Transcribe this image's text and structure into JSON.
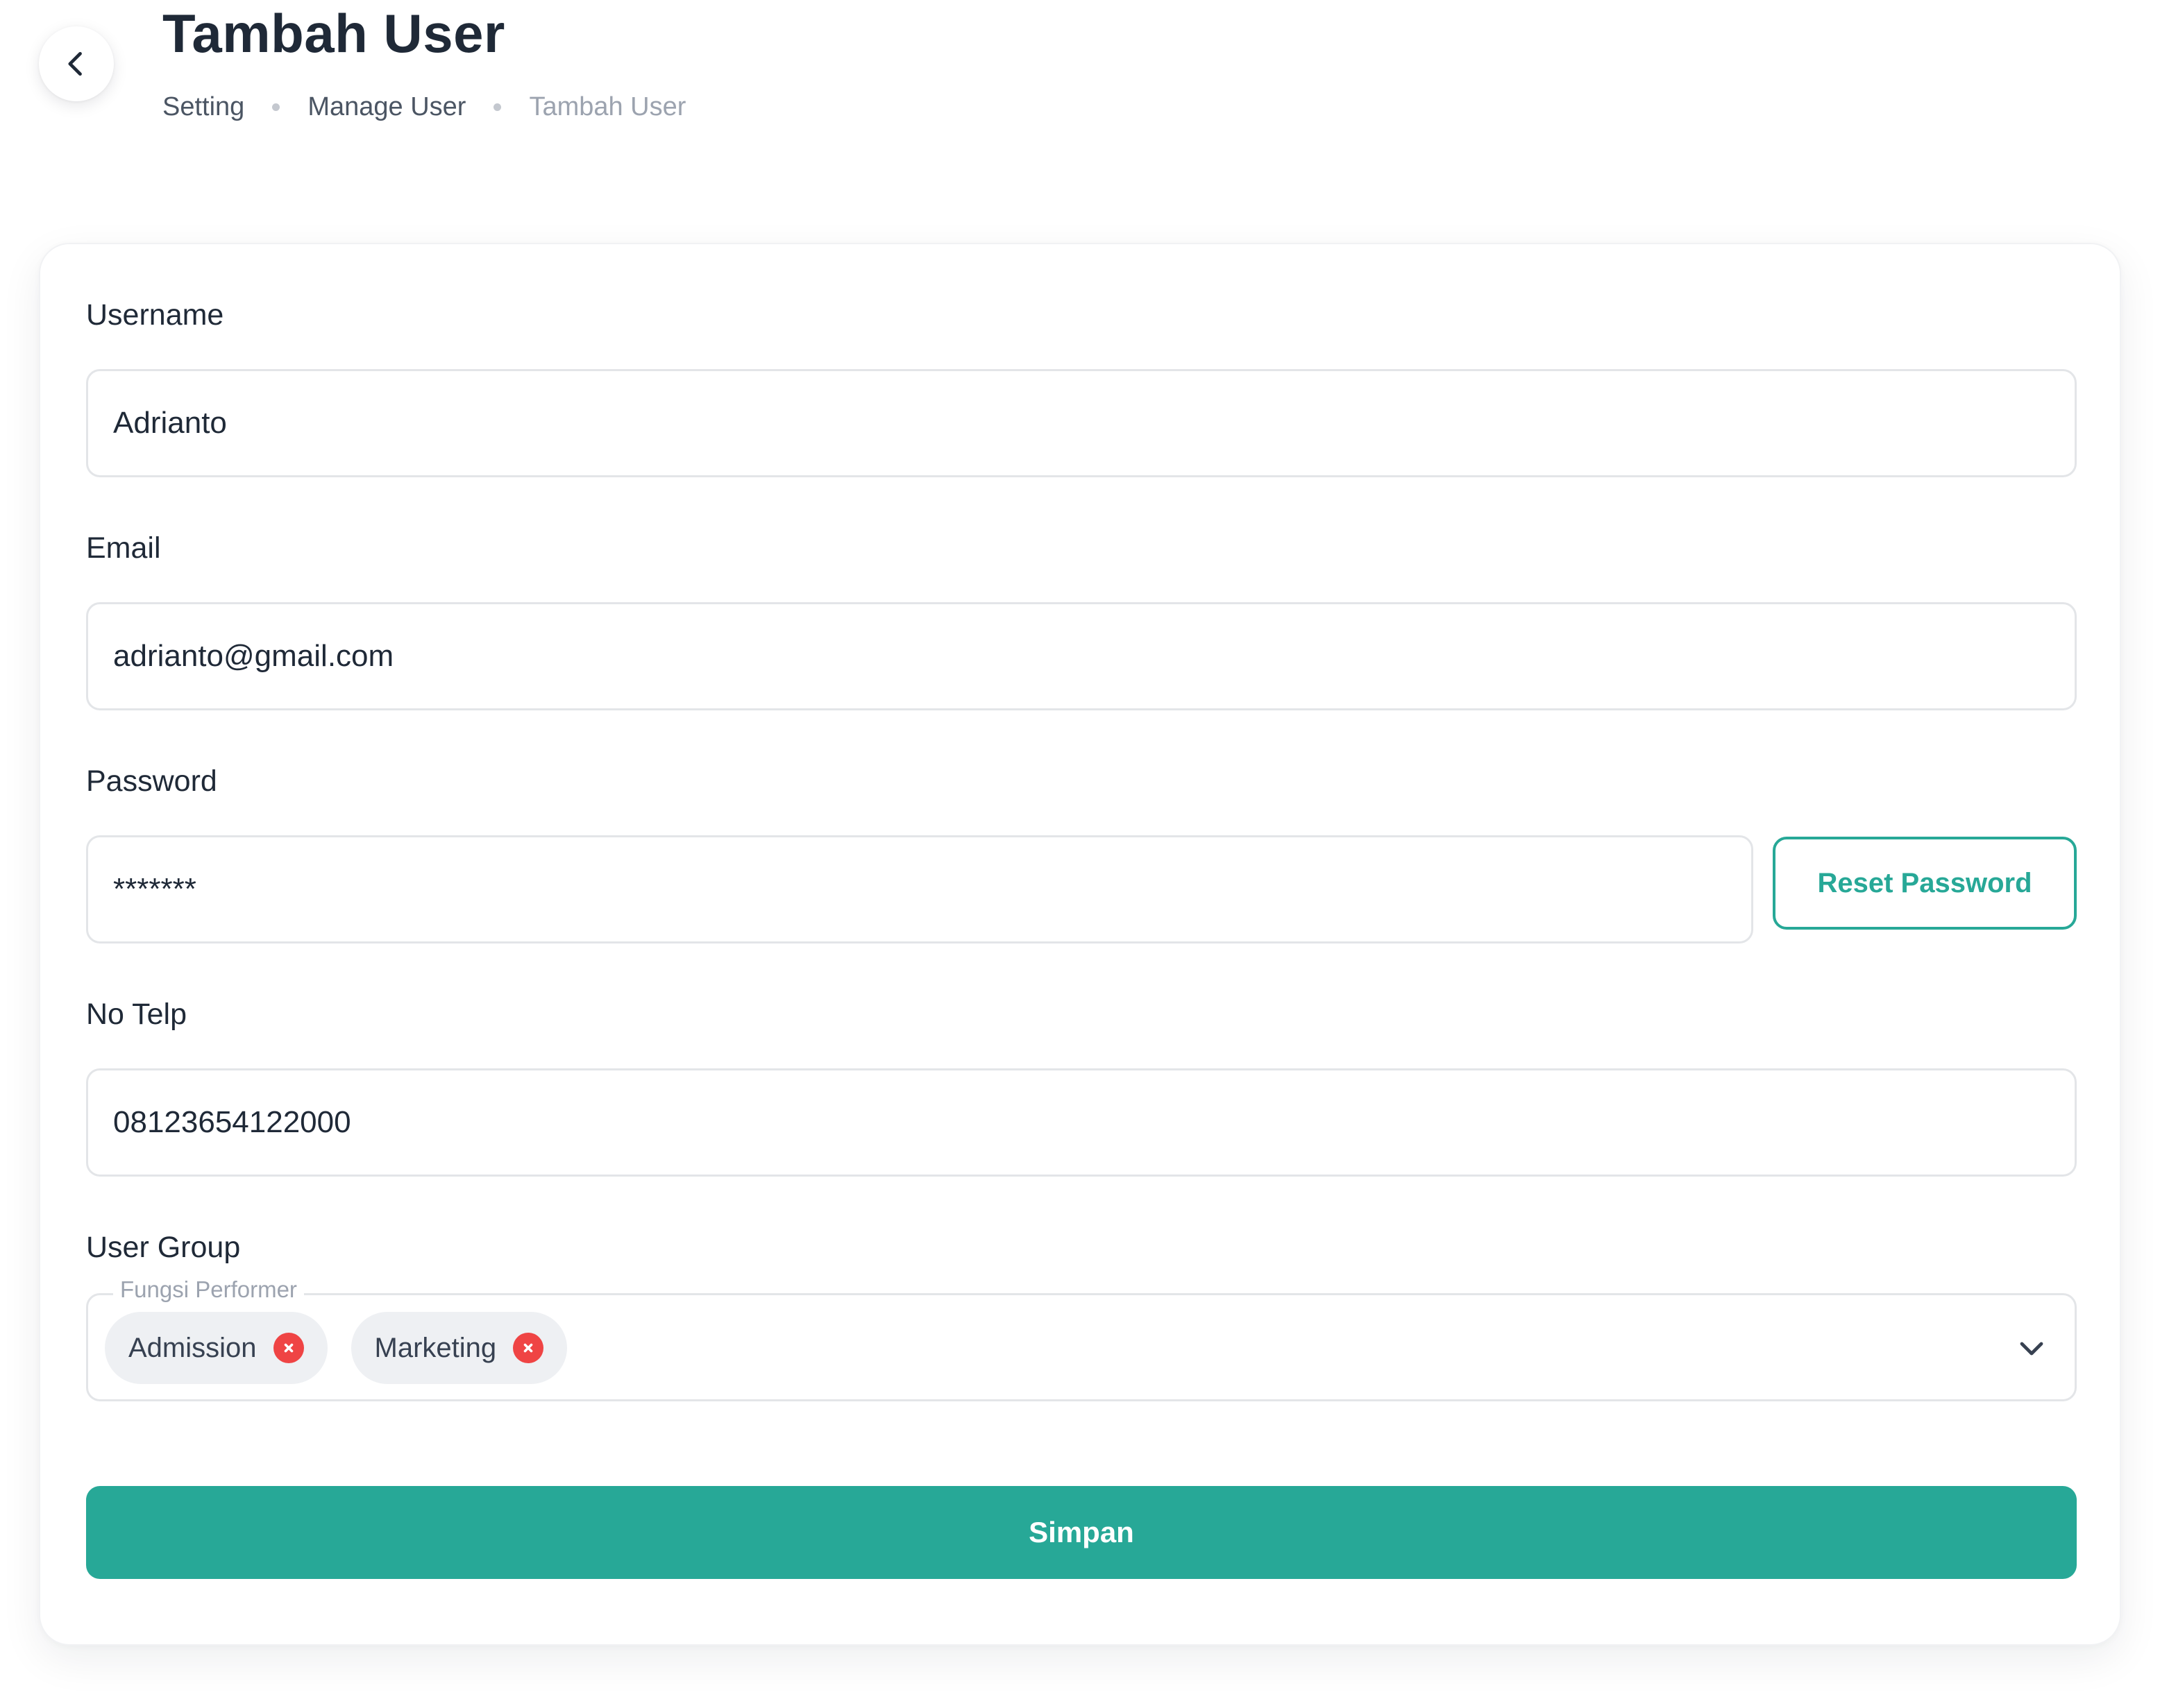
{
  "header": {
    "title": "Tambah User",
    "breadcrumb": [
      "Setting",
      "Manage User",
      "Tambah User"
    ]
  },
  "form": {
    "username": {
      "label": "Username",
      "value": "Adrianto"
    },
    "email": {
      "label": "Email",
      "value": "adrianto@gmail.com"
    },
    "password": {
      "label": "Password",
      "value": "*******",
      "reset_label": "Reset Password"
    },
    "phone": {
      "label": "No Telp",
      "value": "08123654122000"
    },
    "user_group": {
      "label": "User Group",
      "legend": "Fungsi Performer",
      "chips": [
        "Admission",
        "Marketing"
      ]
    },
    "submit_label": "Simpan"
  },
  "colors": {
    "accent": "#27a897",
    "remove": "#ef4444",
    "title": "#1f2937",
    "muted": "#9ca3af"
  },
  "icons": {
    "back": "chevron-left-icon",
    "chip_remove": "close-icon",
    "dropdown": "chevron-down-icon"
  }
}
